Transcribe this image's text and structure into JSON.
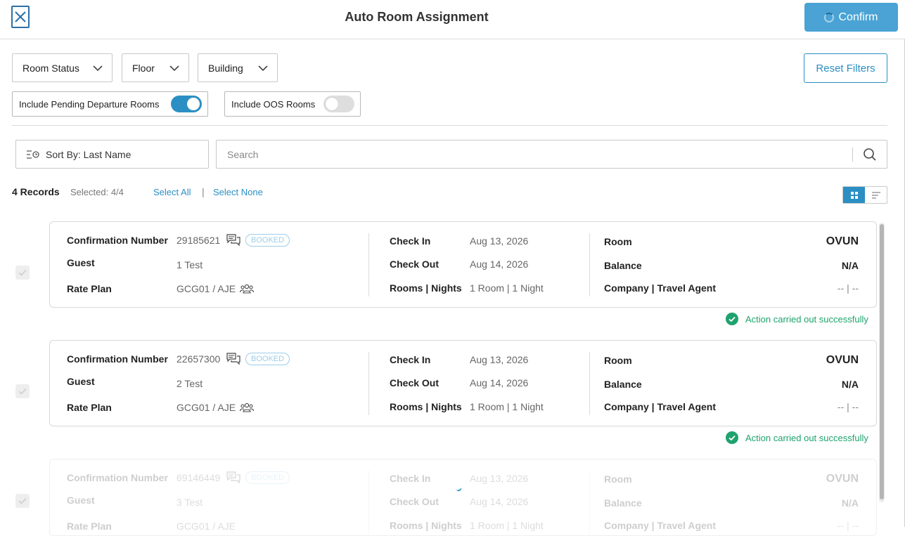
{
  "header": {
    "title": "Auto Room Assignment",
    "confirm_label": "Confirm"
  },
  "filters": {
    "room_status": "Room Status",
    "floor": "Floor",
    "building": "Building",
    "reset_label": "Reset Filters",
    "pending_departure_label": "Include Pending Departure Rooms",
    "pending_departure_on": true,
    "oos_label": "Include OOS Rooms",
    "oos_on": false
  },
  "toolbar": {
    "sort_label": "Sort By: Last Name",
    "search_placeholder": "Search"
  },
  "summary": {
    "records": "4 Records",
    "selected": "Selected: 4/4",
    "select_all": "Select All",
    "separator": "|",
    "select_none": "Select None"
  },
  "labels": {
    "confirmation_number": "Confirmation Number",
    "guest": "Guest",
    "rate_plan": "Rate Plan",
    "check_in": "Check In",
    "check_out": "Check Out",
    "rooms_nights": "Rooms | Nights",
    "room": "Room",
    "balance": "Balance",
    "company": "Company | Travel Agent"
  },
  "reservations": [
    {
      "confirmation": "29185621",
      "status": "BOOKED",
      "guest": "1 Test",
      "rate_plan": "GCG01 / AJE",
      "check_in": "Aug 13, 2026",
      "check_out": "Aug 14, 2026",
      "rooms_nights": "1 Room | 1 Night",
      "room": "OVUN",
      "balance": "N/A",
      "company": "-- | --",
      "result": "Action carried out successfully"
    },
    {
      "confirmation": "22657300",
      "status": "BOOKED",
      "guest": "2 Test",
      "rate_plan": "GCG01 / AJE",
      "check_in": "Aug 13, 2026",
      "check_out": "Aug 14, 2026",
      "rooms_nights": "1 Room | 1 Night",
      "room": "OVUN",
      "balance": "N/A",
      "company": "-- | --",
      "result": "Action carried out successfully"
    },
    {
      "confirmation": "69146449",
      "status": "BOOKED",
      "guest": "3 Test",
      "rate_plan": "GCG01 / AJE",
      "check_in": "Aug 13, 2026",
      "check_out": "Aug 14, 2026",
      "rooms_nights": "1 Room | 1 Night",
      "room": "OVUN",
      "balance": "N/A",
      "company": "-- | --"
    }
  ],
  "colors": {
    "accent": "#2b8fc4",
    "confirm_bg": "#4aa3d4",
    "success": "#1ea36e",
    "badge": "#9ccde8"
  }
}
